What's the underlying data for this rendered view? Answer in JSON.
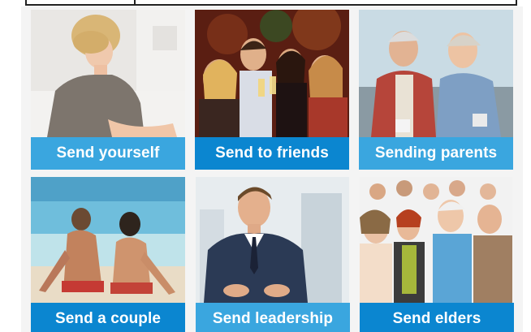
{
  "cards": [
    {
      "label": "Send yourself",
      "photo": "woman-reading-photo"
    },
    {
      "label": "Send to friends",
      "photo": "friends-toasting-photo"
    },
    {
      "label": "Sending parents",
      "photo": "elderly-couple-photo"
    },
    {
      "label": "Send a couple",
      "photo": "couple-on-beach-photo"
    },
    {
      "label": "Send leadership",
      "photo": "businessman-photo"
    },
    {
      "label": "Send elders",
      "photo": "group-of-people-photo"
    }
  ],
  "colors": {
    "label_light": "#3aa6df",
    "label_dark": "#0b86d0"
  }
}
